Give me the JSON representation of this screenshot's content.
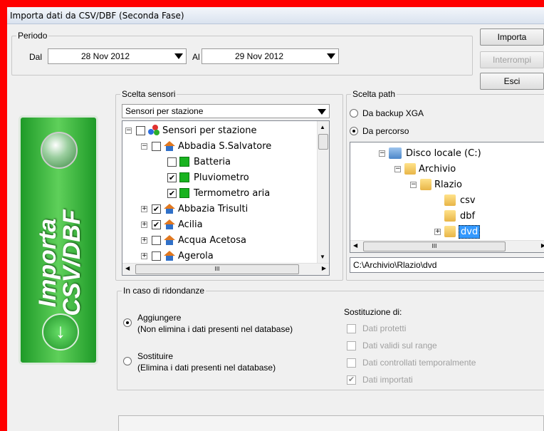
{
  "window": {
    "title": "Importa dati da CSV/DBF (Seconda Fase)"
  },
  "periodo": {
    "caption": "Periodo",
    "dal_label": "Dal",
    "dal_value": "28 Nov 2012",
    "al_label": "Al",
    "al_value": "29 Nov 2012"
  },
  "buttons": {
    "importa": "Importa",
    "interrompi": "Interrompi",
    "esci": "Esci"
  },
  "banner": {
    "line1": "Importa",
    "line2": "CSV/DBF"
  },
  "sensori": {
    "caption": "Scelta sensori",
    "combo_value": "Sensori per stazione",
    "tree": [
      {
        "label": "Sensori per stazione",
        "checked": false
      },
      {
        "label": "Abbadia S.Salvatore",
        "checked": false
      },
      {
        "label": "Batteria",
        "checked": false
      },
      {
        "label": "Pluviometro",
        "checked": true
      },
      {
        "label": "Termometro aria",
        "checked": true
      },
      {
        "label": "Abbazia Trisulti",
        "checked": true
      },
      {
        "label": "Acilia",
        "checked": true
      },
      {
        "label": "Acqua Acetosa",
        "checked": false
      },
      {
        "label": "Agerola",
        "checked": false
      }
    ],
    "scroll_thumb": "III"
  },
  "path": {
    "caption": "Scelta path",
    "opt_backup": "Da backup XGA",
    "opt_percorso": "Da percorso",
    "tree": [
      "Disco locale (C:)",
      "Archivio",
      "Rlazio",
      "csv",
      "dbf",
      "dvd"
    ],
    "scroll_thumb": "III",
    "current": "C:\\Archivio\\Rlazio\\dvd"
  },
  "ridondanze": {
    "caption": "In caso di ridondanze",
    "opt_agg": "Aggiungere",
    "opt_agg_note": "(Non elimina i dati presenti nel database)",
    "opt_sost": "Sostituire",
    "opt_sost_note": "(Elimina i dati presenti nel database)",
    "sostituzione_label": "Sostituzione di:",
    "checks": [
      {
        "label": "Dati protetti",
        "checked": false
      },
      {
        "label": "Dati validi sul range",
        "checked": false
      },
      {
        "label": "Dati controllati temporalmente",
        "checked": false
      },
      {
        "label": "Dati importati",
        "checked": true
      }
    ]
  }
}
